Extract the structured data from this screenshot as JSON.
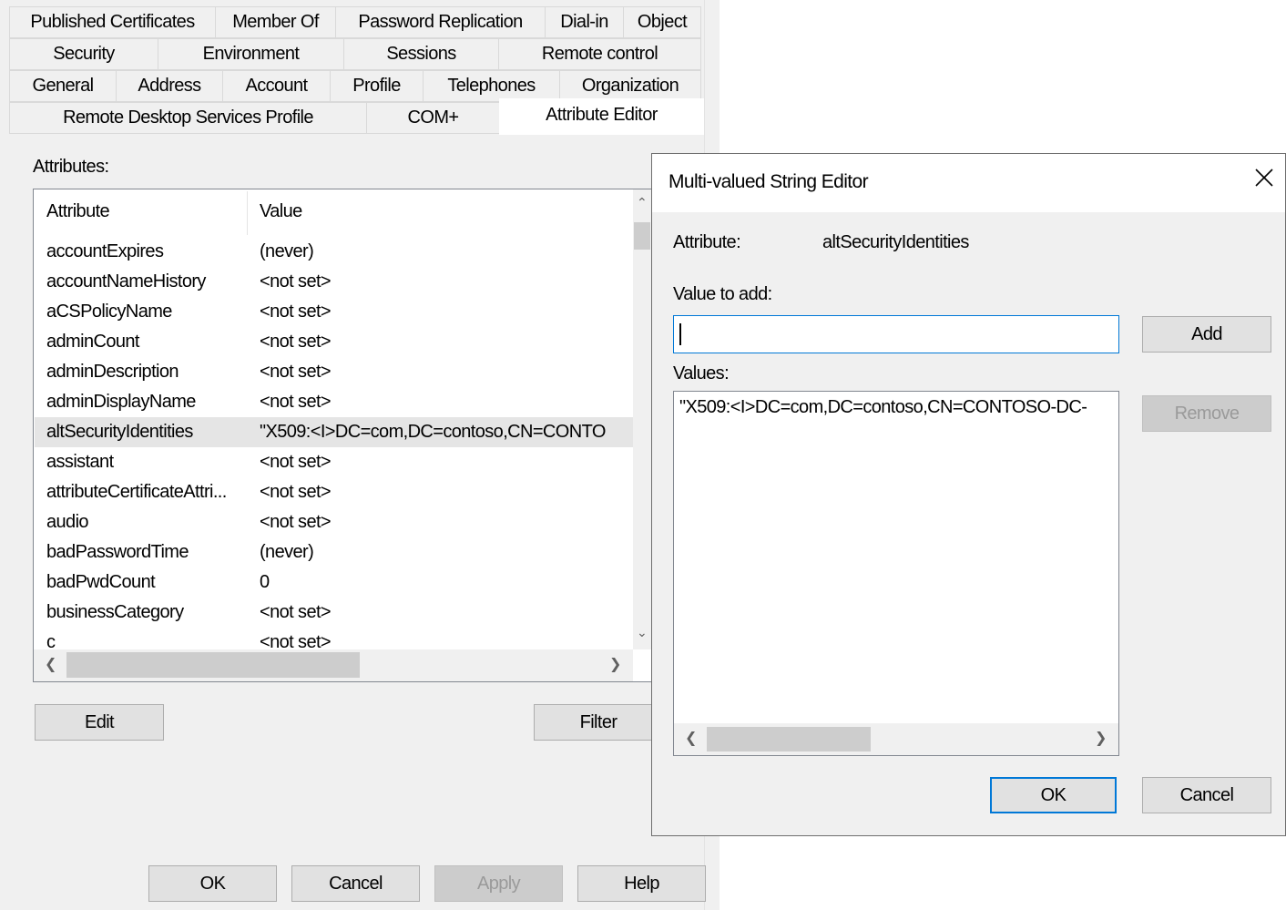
{
  "tabs": {
    "row1": [
      "Published Certificates",
      "Member Of",
      "Password Replication",
      "Dial-in",
      "Object"
    ],
    "row2": [
      "Security",
      "Environment",
      "Sessions",
      "Remote control"
    ],
    "row3": [
      "General",
      "Address",
      "Account",
      "Profile",
      "Telephones",
      "Organization"
    ],
    "row4": [
      "Remote Desktop Services Profile",
      "COM+",
      "Attribute Editor"
    ],
    "active": "Attribute Editor"
  },
  "attribute_editor": {
    "caption": "Attributes:",
    "columns": [
      "Attribute",
      "Value"
    ],
    "rows": [
      {
        "name": "accountExpires",
        "value": "(never)"
      },
      {
        "name": "accountNameHistory",
        "value": "<not set>"
      },
      {
        "name": "aCSPolicyName",
        "value": "<not set>"
      },
      {
        "name": "adminCount",
        "value": "<not set>"
      },
      {
        "name": "adminDescription",
        "value": "<not set>"
      },
      {
        "name": "adminDisplayName",
        "value": "<not set>"
      },
      {
        "name": "altSecurityIdentities",
        "value": "\"X509:<I>DC=com,DC=contoso,CN=CONTO"
      },
      {
        "name": "assistant",
        "value": "<not set>"
      },
      {
        "name": "attributeCertificateAttri...",
        "value": "<not set>"
      },
      {
        "name": "audio",
        "value": "<not set>"
      },
      {
        "name": "badPasswordTime",
        "value": "(never)"
      },
      {
        "name": "badPwdCount",
        "value": "0"
      },
      {
        "name": "businessCategory",
        "value": "<not set>"
      },
      {
        "name": "c",
        "value": "<not set>"
      }
    ],
    "selected_row": "altSecurityIdentities",
    "edit_label": "Edit",
    "filter_label": "Filter"
  },
  "footer": {
    "ok": "OK",
    "cancel": "Cancel",
    "apply": "Apply",
    "help": "Help"
  },
  "dialog": {
    "title": "Multi-valued String Editor",
    "attribute_label": "Attribute:",
    "attribute_value": "altSecurityIdentities",
    "value_to_add_label": "Value to add:",
    "value_to_add": "",
    "add_label": "Add",
    "values_label": "Values:",
    "values": [
      "\"X509:<I>DC=com,DC=contoso,CN=CONTOSO-DC-"
    ],
    "remove_label": "Remove",
    "ok_label": "OK",
    "cancel_label": "Cancel"
  }
}
